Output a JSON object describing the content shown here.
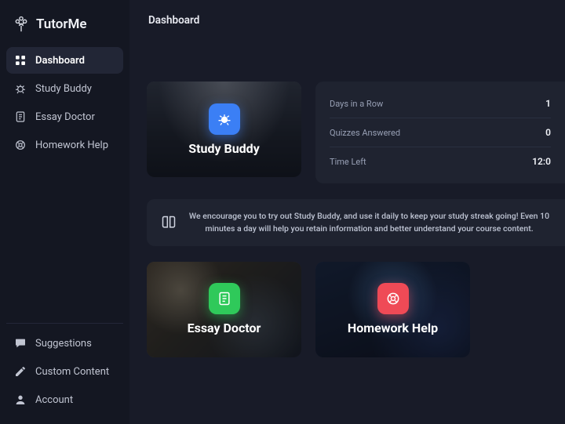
{
  "brand": {
    "name": "TutorMe"
  },
  "page": {
    "title": "Dashboard"
  },
  "nav": {
    "items": [
      {
        "label": "Dashboard"
      },
      {
        "label": "Study Buddy"
      },
      {
        "label": "Essay Doctor"
      },
      {
        "label": "Homework Help"
      }
    ],
    "bottom": [
      {
        "label": "Suggestions"
      },
      {
        "label": "Custom Content"
      },
      {
        "label": "Account"
      }
    ]
  },
  "cards": {
    "study": {
      "title": "Study Buddy"
    },
    "essay": {
      "title": "Essay Doctor"
    },
    "homework": {
      "title": "Homework Help"
    }
  },
  "stats": [
    {
      "label": "Days in a Row",
      "value": "1"
    },
    {
      "label": "Quizzes Answered",
      "value": "0"
    },
    {
      "label": "Time Left",
      "value": "12:0"
    }
  ],
  "tip": {
    "text": "We encourage you to try out Study Buddy, and use it daily to keep your study streak going! Even 10 minutes a day will help you retain information and better understand your course content."
  }
}
